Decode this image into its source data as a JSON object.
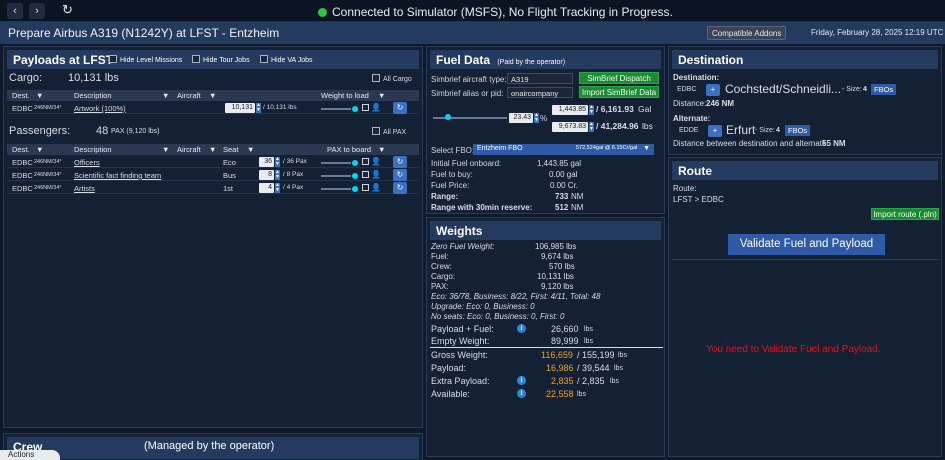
{
  "topbar": {
    "status": "Connected to Simulator (MSFS), No Flight Tracking in Progress."
  },
  "header": {
    "title": "Prepare Airbus A319 (N1242Y) at LFST - Entzheim",
    "compat_button": "Compatible Addons",
    "datetime": "Friday, February 28, 2025 12:19 UTC"
  },
  "payloads": {
    "title": "Payloads at LFST",
    "options": [
      "Hide Level Missions",
      "Hide Tour Jobs",
      "Hide VA Jobs"
    ],
    "cargo_label": "Cargo:",
    "cargo_total": "10,131 lbs",
    "all_cargo": "All Cargo",
    "cargo_headers": [
      "Dest.",
      "Description",
      "Aircraft",
      "Weight to load"
    ],
    "cargo_rows": [
      {
        "dest": "EDBC",
        "dist": "246NM/34°",
        "desc": "Artwork (100%)",
        "value": "10,131",
        "of": "/ 10,131 lbs"
      }
    ],
    "pax_label": "Passengers:",
    "pax_total": "48",
    "pax_unit": "PAX (9,120 lbs)",
    "all_pax": "All PAX",
    "pax_headers": [
      "Dest.",
      "Description",
      "Aircraft",
      "Seat",
      "PAX to board"
    ],
    "pax_rows": [
      {
        "dest": "EDBC",
        "dist": "246NM/34°",
        "desc": "Officers",
        "seat": "Eco",
        "value": "36",
        "of": "/ 36 Pax"
      },
      {
        "dest": "EDBC",
        "dist": "246NM/34°",
        "desc": "Scientific fact finding team",
        "seat": "Bus",
        "value": "8",
        "of": "/ 8 Pax"
      },
      {
        "dest": "EDBC",
        "dist": "246NM/34°",
        "desc": "Artists",
        "seat": "1st",
        "value": "4",
        "of": "/ 4 Pax"
      }
    ]
  },
  "crew": {
    "title": "Crew",
    "note": "(Managed by the operator)",
    "partial": "Actions"
  },
  "fuel": {
    "title": "Fuel Data",
    "paid": "(Paid by the operator)",
    "type_label": "Simbrief aircraft type:",
    "type_value": "A319",
    "dispatch": "SimBrief Dispatch",
    "alias_label": "Simbrief alias or pid:",
    "alias_value": "onaircompany",
    "import": "Import SimBrief Data",
    "pct": "23.43",
    "pct_unit": "%",
    "gal_value": "1,443.85",
    "gal_total": "/ 6,161.93",
    "gal_unit": "Gal",
    "lbs_value": "9,673.83",
    "lbs_total": "/ 41,284.96",
    "lbs_unit": "lbs",
    "fbo_label": "Select FBO:",
    "fbo_name": "Entzheim FBO",
    "fbo_price": "572,524gal @ 6.15Cr/gal",
    "initial_label": "Initial Fuel onboard:",
    "initial_value": "1,443.85 gal",
    "buy_label": "Fuel to buy:",
    "buy_value": "0.00 gal",
    "price_label": "Fuel Price:",
    "price_value": "0.00 Cr.",
    "range_label": "Range:",
    "range_value": "733",
    "range_unit": "NM",
    "reserve_label": "Range with 30min reserve:",
    "reserve_value": "512",
    "reserve_unit": "NM"
  },
  "weights": {
    "title": "Weights",
    "lines": [
      {
        "label": "Zero Fuel Weight:",
        "value": "106,985 lbs"
      },
      {
        "label": "Fuel:",
        "value": "9,674 lbs"
      },
      {
        "label": "Crew:",
        "value": "570 lbs"
      },
      {
        "label": "Cargo:",
        "value": "10,131 lbs"
      },
      {
        "label": "PAX:",
        "value": "9,120 lbs"
      }
    ],
    "seats": "Eco: 36/78, Business: 8/22, First: 4/11, Total: 48",
    "upgrade": "Upgrade: Eco: 0, Business: 0",
    "noseats": "No seats: Eco: 0, Business: 0, First: 0",
    "payload_fuel_label": "Payload + Fuel:",
    "payload_fuel_value": "26,660",
    "payload_fuel_unit": "lbs",
    "empty_label": "Empty Weight:",
    "empty_value": "89,999",
    "empty_unit": "lbs",
    "gross_label": "Gross Weight:",
    "gross_value": "116,659",
    "gross_max": "/ 155,199",
    "gross_unit": "lbs",
    "payload_label": "Payload:",
    "payload_value": "16,986",
    "payload_max": "/ 39,544",
    "payload_unit": "lbs",
    "extra_label": "Extra Payload:",
    "extra_value": "2,835",
    "extra_max": "/ 2,835",
    "extra_unit": "lbs",
    "avail_label": "Available:",
    "avail_value": "22,558",
    "avail_unit": "lbs"
  },
  "destination": {
    "title": "Destination",
    "dest_label": "Destination:",
    "dest_code": "EDBC",
    "dest_name": "Cochstedt/Schneidli...",
    "dest_size": "- Size:",
    "dest_size_value": "4",
    "fbos": "FBOs",
    "distance_label": "Distance:",
    "distance_value": "246 NM",
    "alt_label": "Alternate:",
    "alt_code": "EDDE",
    "alt_name": "Erfurt",
    "alt_size": "- Size:",
    "alt_size_value": "4",
    "alt_distance_label": "Distance between destination and alternate:",
    "alt_distance_value": "55 NM"
  },
  "route": {
    "title": "Route",
    "route_label": "Route:",
    "route_value": "LFST > EDBC",
    "import": "Import route (.pln)",
    "validate": "Validate Fuel and Payload",
    "warning": "You need to Validate Fuel and Payload."
  }
}
